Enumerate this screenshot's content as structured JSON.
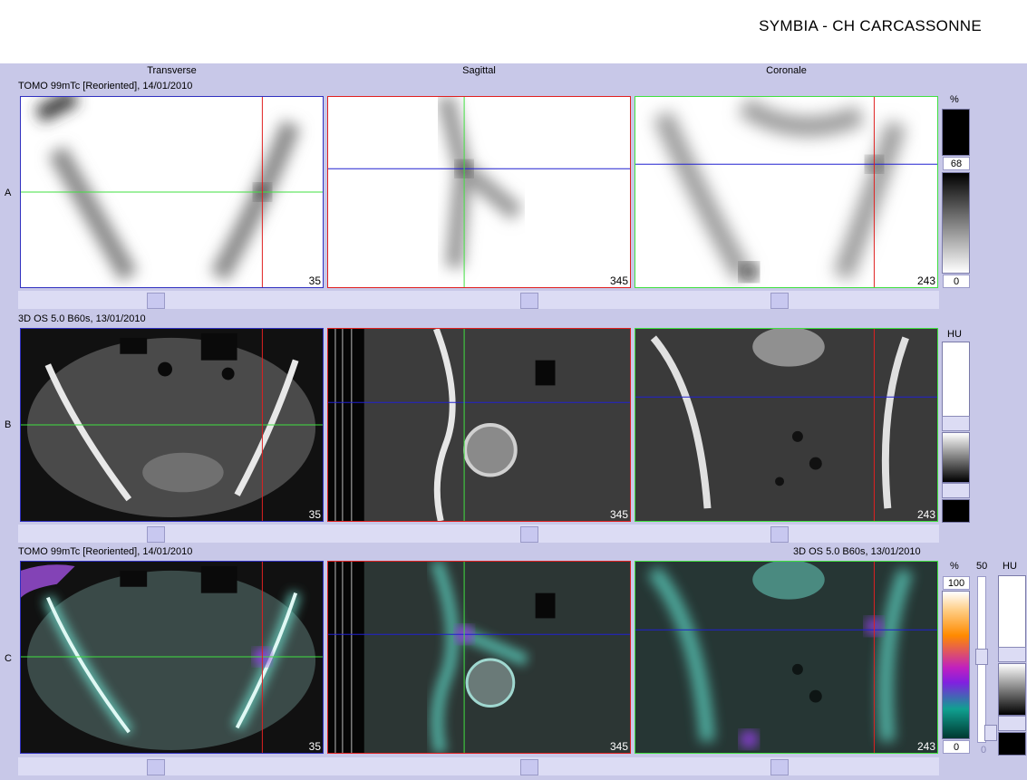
{
  "header": {
    "title": "SYMBIA - CH CARCASSONNE"
  },
  "columns": [
    "Transverse",
    "Sagittal",
    "Coronale"
  ],
  "rows": [
    {
      "letter": "A",
      "series": "TOMO 99mTc [Reoriented], 14/01/2010",
      "slices": [
        "35",
        "345",
        "243"
      ]
    },
    {
      "letter": "B",
      "series": "3D  OS  5.0  B60s, 13/01/2010",
      "slices": [
        "35",
        "345",
        "243"
      ]
    },
    {
      "letter": "C",
      "series": "TOMO 99mTc [Reoriented], 14/01/2010",
      "series_right": "3D  OS  5.0  B60s, 13/01/2010",
      "slices": [
        "35",
        "345",
        "243"
      ]
    }
  ],
  "scales": {
    "a": {
      "unit": "%",
      "top_value": "68",
      "bottom_value": "0"
    },
    "b": {
      "unit": "HU"
    },
    "c": {
      "unit_left": "%",
      "unit_mid": "50",
      "unit_right": "HU",
      "top_value": "100",
      "bottom_value": "0",
      "fusion_bottom": "0"
    }
  },
  "colors": {
    "panel_bg": "#c8c8e8",
    "cursor_red": "#e02020",
    "cursor_green": "#40e040",
    "cursor_blue": "#2020d0"
  }
}
